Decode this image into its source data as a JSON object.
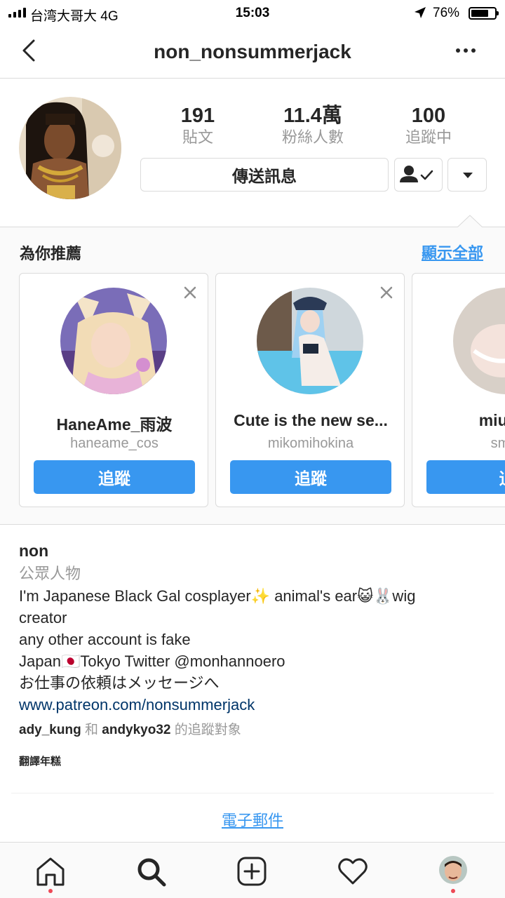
{
  "status_bar": {
    "carrier": "台湾大哥大  4G",
    "time": "15:03",
    "battery_percent": "76%",
    "battery_level": 0.76,
    "icons": [
      "signal-icon",
      "location-arrow-icon",
      "battery-icon"
    ]
  },
  "header": {
    "username": "non_nonsummerjack",
    "icons": [
      "back-chevron-icon",
      "more-dots-icon"
    ]
  },
  "profile": {
    "stats": [
      {
        "value": "191",
        "label": "貼文"
      },
      {
        "value": "11.4萬",
        "label": "粉絲人數"
      },
      {
        "value": "100",
        "label": "追蹤中"
      }
    ],
    "message_button": "傳送訊息",
    "icons": [
      "person-check-icon",
      "caret-down-icon"
    ]
  },
  "suggestions": {
    "title": "為你推薦",
    "see_all": "顯示全部",
    "cards": [
      {
        "name": "HaneAme_雨波",
        "handle": "haneame_cos",
        "follow": "追蹤"
      },
      {
        "name": "Cute is the new se...",
        "handle": "mikomihokina",
        "follow": "追蹤"
      },
      {
        "name": "miu_co",
        "handle": "smile",
        "follow": "追"
      }
    ],
    "icons": [
      "close-x-icon"
    ]
  },
  "bio": {
    "name": "non",
    "category": "公眾人物",
    "lines": [
      "I'm Japanese Black Gal cosplayer✨ animal's ear😺🐰wig",
      "creator",
      "any other account is fake",
      "Japan🇯🇵Tokyo Twitter @monhannoero",
      "お仕事の依頼はメッセージへ"
    ],
    "link": "www.patreon.com/nonsummerjack",
    "followed_by_1": "ady_kung",
    "followed_by_and": " 和 ",
    "followed_by_2": "andykyo32",
    "followed_by_suffix": " 的追蹤對象",
    "translate": "翻譯年糕",
    "email": "電子郵件"
  },
  "tab_bar": {
    "icons": [
      "home-icon",
      "search-icon",
      "new-post-icon",
      "activity-heart-icon",
      "profile-avatar-icon"
    ]
  },
  "colors": {
    "accent": "#3897f0",
    "text": "#262626",
    "secondary": "#999999",
    "link_dark": "#003569",
    "notification_dot": "#ed4956",
    "border": "#dbdbdb"
  }
}
